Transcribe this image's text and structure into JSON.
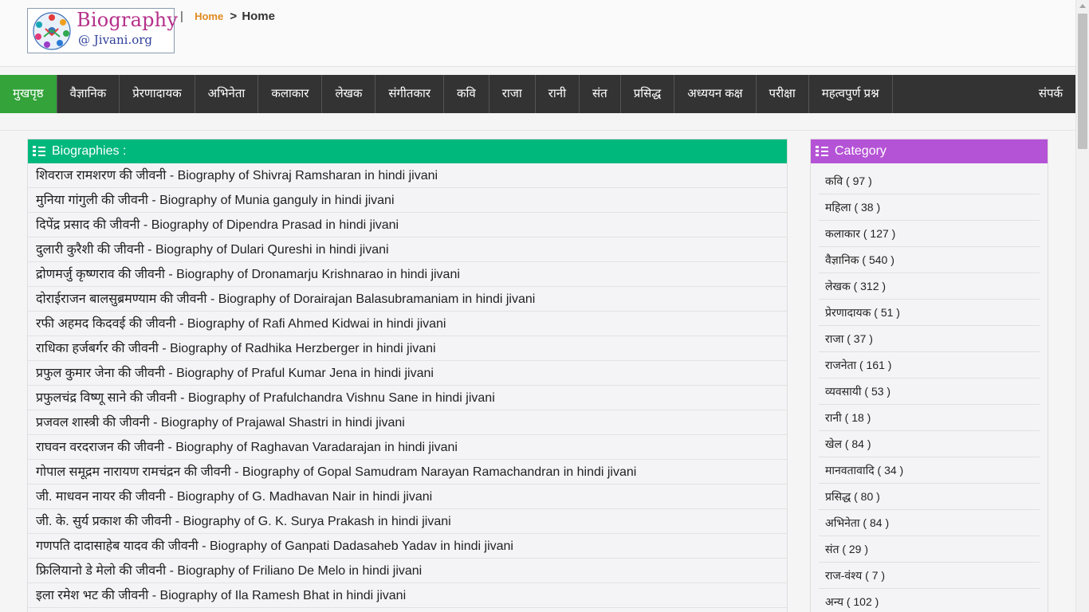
{
  "logo": {
    "title": "Biography",
    "subtitle": "@ Jivani.org",
    "icon": "globe-people-icon"
  },
  "breadcrumb": {
    "separator": "|",
    "home_link": "Home",
    "arrow": ">",
    "current": "Home"
  },
  "nav": {
    "items": [
      {
        "label": "मुखपृष्ठ",
        "active": true
      },
      {
        "label": "वैज्ञानिक"
      },
      {
        "label": "प्रेरणादायक"
      },
      {
        "label": "अभिनेता"
      },
      {
        "label": "कलाकार"
      },
      {
        "label": "लेखक"
      },
      {
        "label": "संगीतकार"
      },
      {
        "label": "कवि"
      },
      {
        "label": "राजा"
      },
      {
        "label": "रानी"
      },
      {
        "label": "संत"
      },
      {
        "label": "प्रसिद्ध"
      },
      {
        "label": "अध्ययन कक्ष"
      },
      {
        "label": "परीक्षा"
      },
      {
        "label": "महत्वपुर्ण प्रश्न"
      }
    ],
    "contact": "संपर्क"
  },
  "biographies": {
    "heading": "Biographies :",
    "icon": "list-icon",
    "items": [
      "शिवराज रामशरण की जीवनी - Biography of Shivraj Ramsharan in hindi jivani",
      "मुनिया गांगुली की जीवनी - Biography of Munia ganguly in hindi jivani",
      "दिपेंद्र प्रसाद की जीवनी - Biography of Dipendra Prasad in hindi jivani",
      "दुलारी कुरैशी की जीवनी - Biography of Dulari Qureshi in hindi jivani",
      "द्रोणमर्जु कृष्णराव की जीवनी - Biography of Dronamarju Krishnarao in hindi jivani",
      "दोराईराजन बालसुब्रमण्याम की जीवनी - Biography of Dorairajan Balasubramaniam in hindi jivani",
      "रफी अहमद किदवई की जीवनी - Biography of Rafi Ahmed Kidwai in hindi jivani",
      "राधिका हर्जबर्गर की जीवनी - Biography of Radhika Herzberger in hindi jivani",
      "प्रफुल कुमार जेना की जीवनी - Biography of Praful Kumar Jena in hindi jivani",
      "प्रफुलचंद्र विष्णू साने की जीवनी - Biography of Prafulchandra Vishnu Sane in hindi jivani",
      "प्रजवल शास्त्री की जीवनी - Biography of Prajawal Shastri in hindi jivani",
      "राघवन वरदराजन की जीवनी - Biography of Raghavan Varadarajan in hindi jivani",
      "गोपाल समूद्रम नारायण रामचंद्रन की जीवनी - Biography of Gopal Samudram Narayan Ramachandran in hindi jivani",
      "जी. माधवन नायर की जीवनी - Biography of G. Madhavan Nair in hindi jivani",
      "जी. के. सुर्य प्रकाश की जीवनी - Biography of G. K. Surya Prakash in hindi jivani",
      "गणपति दादासाहेब यादव की जीवनी - Biography of Ganpati Dadasaheb Yadav in hindi jivani",
      "फ्रिलियानो डे मेलो की जीवनी - Biography of Friliano De Melo in hindi jivani",
      "इला रमेश भट की जीवनी - Biography of Ila Ramesh Bhat in hindi jivani"
    ]
  },
  "category": {
    "heading": "Category",
    "icon": "list-icon",
    "items": [
      "कवि ( 97 )",
      "महिला ( 38 )",
      "कलाकार ( 127 )",
      "वैज्ञानिक ( 540 )",
      "लेखक ( 312 )",
      "प्रेरणादायक ( 51 )",
      "राजा ( 37 )",
      "राजनेता ( 161 )",
      "व्यवसायी ( 53 )",
      "रानी ( 18 )",
      "खेल ( 84 )",
      "मानवतावादि ( 34 )",
      "प्रसिद्ध ( 80 )",
      "अभिनेता ( 84 )",
      "संत ( 29 )",
      "राज-वंश्य ( 7 )",
      "अन्य ( 102 )"
    ]
  },
  "colors": {
    "nav_bg": "#333333",
    "nav_active": "#33a33a",
    "bio_header": "#00b87c",
    "category_header": "#b553d6",
    "logo_title": "#b5308a",
    "logo_sub": "#2f3f9a",
    "crumb_link": "#e08a1e"
  }
}
